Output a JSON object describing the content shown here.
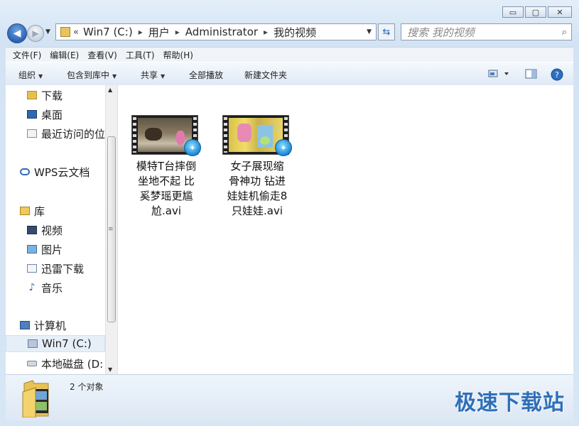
{
  "window": {
    "caption_buttons": {
      "minimize": "▭",
      "maximize": "▢",
      "close": "✕"
    }
  },
  "address_bar": {
    "lead": "«",
    "crumbs": [
      "Win7 (C:)",
      "用户",
      "Administrator",
      "我的视频"
    ],
    "separator": "▸"
  },
  "search": {
    "placeholder": "搜索 我的视频"
  },
  "menu": [
    "文件(F)",
    "编辑(E)",
    "查看(V)",
    "工具(T)",
    "帮助(H)"
  ],
  "toolbar": {
    "organize": "组织",
    "include_in_library": "包含到库中",
    "share": "共享",
    "play_all": "全部播放",
    "new_folder": "新建文件夹"
  },
  "nav_pane": {
    "items": [
      {
        "label": "下载",
        "icon": "folder-icon"
      },
      {
        "label": "桌面",
        "icon": "desktop-icon"
      },
      {
        "label": "最近访问的位置",
        "icon": "recent-places-icon"
      },
      {
        "label": "WPS云文档",
        "icon": "cloud-icon"
      },
      {
        "label": "库",
        "icon": "library-icon"
      },
      {
        "label": "视频",
        "icon": "video-library-icon"
      },
      {
        "label": "图片",
        "icon": "pictures-icon"
      },
      {
        "label": "迅雷下载",
        "icon": "xunlei-download-icon"
      },
      {
        "label": "音乐",
        "icon": "music-icon"
      },
      {
        "label": "计算机",
        "icon": "computer-icon"
      },
      {
        "label": "Win7 (C:)",
        "icon": "system-drive-icon"
      },
      {
        "label": "本地磁盘 (D:",
        "icon": "local-disk-icon"
      }
    ],
    "selected": "Win7 (C:)"
  },
  "files": [
    {
      "name": "模特T台摔倒坐地不起 比奚梦瑶更尴尬.avi",
      "lines": [
        "模特T台摔倒",
        "坐地不起 比",
        "奚梦瑶更尴",
        "尬.avi"
      ]
    },
    {
      "name": "女子展现缩骨神功 钻进娃娃机偷走8只娃娃.avi",
      "lines": [
        "女子展现缩",
        "骨神功 钻进",
        "娃娃机偷走8",
        "只娃娃.avi"
      ]
    }
  ],
  "details": {
    "count_text": "2 个对象"
  },
  "watermark": "极速下载站",
  "colors": {
    "accent": "#2e6fb8",
    "selection": "#e6eef8"
  }
}
